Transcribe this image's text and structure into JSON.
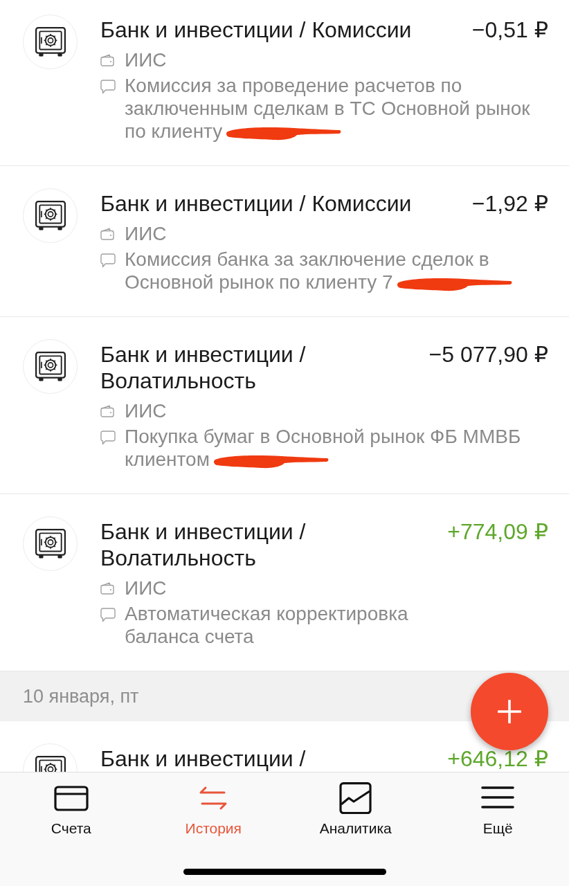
{
  "groups": [
    {
      "transactions": [
        {
          "title": "Банк и инвестиции / Комиссии",
          "amount": "−0,51 ₽",
          "color": "#1c1c1e",
          "account": "ИИС",
          "note": [
            "Комиссия за проведение расчетов по",
            "заключенным сделкам в ТС Основной рынок",
            "по клиенту"
          ],
          "redacted": true
        },
        {
          "title": "Банк и инвестиции / Комиссии",
          "amount": "−1,92 ₽",
          "color": "#1c1c1e",
          "account": "ИИС",
          "note": [
            "Комиссия банка за заключение сделок в",
            "Основной рынок по клиенту 7"
          ],
          "redacted": true
        },
        {
          "title": "Банк и инвестиции / Волатильность",
          "amount": "−5 077,90 ₽",
          "color": "#1c1c1e",
          "account": "ИИС",
          "note": [
            "Покупка бумаг в Основной рынок ФБ ММВБ",
            "клиентом"
          ],
          "redacted": true
        },
        {
          "title": "Банк и инвестиции / Волатильность",
          "amount": "+774,09 ₽",
          "color": "#5ea72b",
          "account": "ИИС",
          "note": [
            "Автоматическая корректировка",
            "баланса счета"
          ],
          "redacted": false
        }
      ]
    },
    {
      "date": "10 января, пт",
      "transactions": [
        {
          "title": "Банк и инвестиции /",
          "amount": "+646,12 ₽",
          "color": "#5ea72b"
        }
      ]
    }
  ],
  "tab_bar": [
    {
      "label": "Счета",
      "selected": false
    },
    {
      "label": "История",
      "selected": true
    },
    {
      "label": "Аналитика",
      "selected": false
    },
    {
      "label": "Ещё",
      "selected": false
    }
  ]
}
